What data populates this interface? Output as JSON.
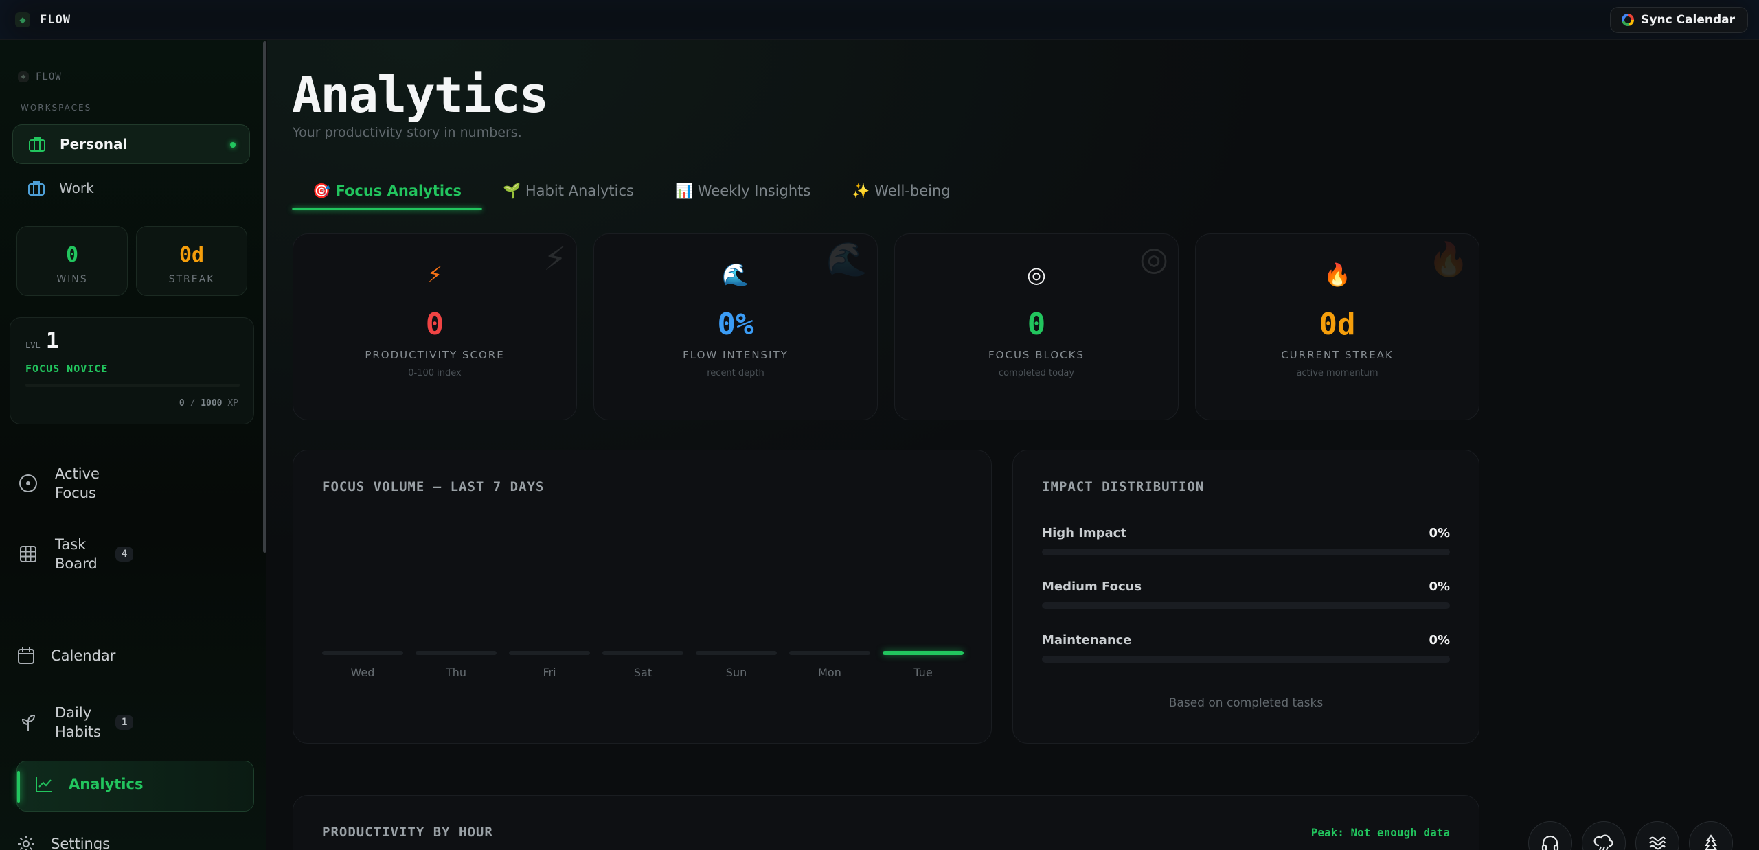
{
  "app": {
    "brand": "FLOW"
  },
  "header": {
    "sync_label": "Sync Calendar"
  },
  "sidebar": {
    "brand": "FLOW",
    "workspaces_label": "WORKSPACES",
    "workspaces": [
      {
        "label": "Personal",
        "active": true
      },
      {
        "label": "Work",
        "active": false
      }
    ],
    "stats": [
      {
        "value": "0",
        "label": "WINS",
        "color": "#22c55e"
      },
      {
        "value": "0d",
        "label": "STREAK",
        "color": "#f59e0b"
      }
    ],
    "level": {
      "prefix": "LVL",
      "value": "1",
      "rank": "FOCUS NOVICE",
      "xp_current": "0",
      "xp_sep": "/",
      "xp_max": "1000",
      "xp_unit": "XP"
    },
    "nav": [
      {
        "label": "Active Focus",
        "icon": "target-icon"
      },
      {
        "label": "Task Board",
        "icon": "grid-icon",
        "badge": "4"
      },
      {
        "label": "Calendar",
        "icon": "calendar-icon"
      },
      {
        "label": "Daily Habits",
        "icon": "sprout-icon",
        "badge": "1"
      },
      {
        "label": "Analytics",
        "icon": "chart-line-icon",
        "active": true
      },
      {
        "label": "Settings",
        "icon": "gear-icon"
      }
    ]
  },
  "main": {
    "title": "Analytics",
    "subtitle": "Your productivity story in numbers.",
    "tabs": [
      {
        "label": "🎯 Focus Analytics",
        "active": true
      },
      {
        "label": "🌱 Habit Analytics"
      },
      {
        "label": "📊 Weekly Insights"
      },
      {
        "label": "✨ Well-being"
      }
    ],
    "kpis": [
      {
        "icon": "⚡",
        "value": "0",
        "label": "PRODUCTIVITY SCORE",
        "sub": "0-100 index",
        "color": "#ef4444"
      },
      {
        "icon": "🌊",
        "value": "0%",
        "label": "FLOW INTENSITY",
        "sub": "recent depth",
        "color": "#3b9cf5"
      },
      {
        "icon": "◎",
        "value": "0",
        "label": "FOCUS BLOCKS",
        "sub": "completed today",
        "color": "#22c55e"
      },
      {
        "icon": "🔥",
        "value": "0d",
        "label": "CURRENT STREAK",
        "sub": "active momentum",
        "color": "#f59e0b"
      }
    ],
    "focus_volume": {
      "title": "FOCUS VOLUME — LAST 7 DAYS",
      "days": [
        "Wed",
        "Thu",
        "Fri",
        "Sat",
        "Sun",
        "Mon",
        "Tue"
      ],
      "highlight_index": 6
    },
    "impact": {
      "title": "IMPACT DISTRIBUTION",
      "rows": [
        {
          "label": "High Impact",
          "value": "0%"
        },
        {
          "label": "Medium Focus",
          "value": "0%"
        },
        {
          "label": "Maintenance",
          "value": "0%"
        }
      ],
      "footnote": "Based on completed tasks"
    },
    "by_hour": {
      "title": "PRODUCTIVITY BY HOUR",
      "peak": "Peak: Not enough data"
    }
  },
  "fabs": [
    "headphones-icon",
    "rain-cloud-icon",
    "waves-icon",
    "tree-icon"
  ],
  "colors": {
    "accent": "#22c55e",
    "streak": "#f59e0b"
  }
}
